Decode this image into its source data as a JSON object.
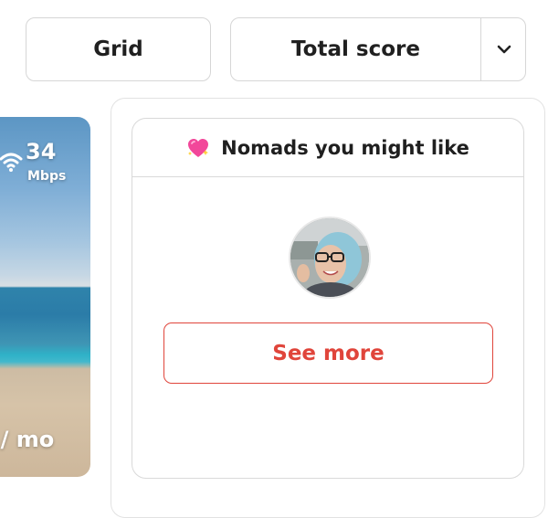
{
  "toolbar": {
    "grid_label": "Grid",
    "sort_label": "Total score"
  },
  "city_card": {
    "internet_speed": "34",
    "internet_unit": "Mbps",
    "price_fragment": "l / mo"
  },
  "nomads": {
    "title": "Nomads you might like",
    "see_more_label": "See more"
  },
  "colors": {
    "accent": "#e0453b",
    "border": "#d6d6d6",
    "text": "#1f1f1f"
  },
  "icons": [
    "chevron-down-icon",
    "wifi-icon",
    "sparkling-heart-icon"
  ]
}
